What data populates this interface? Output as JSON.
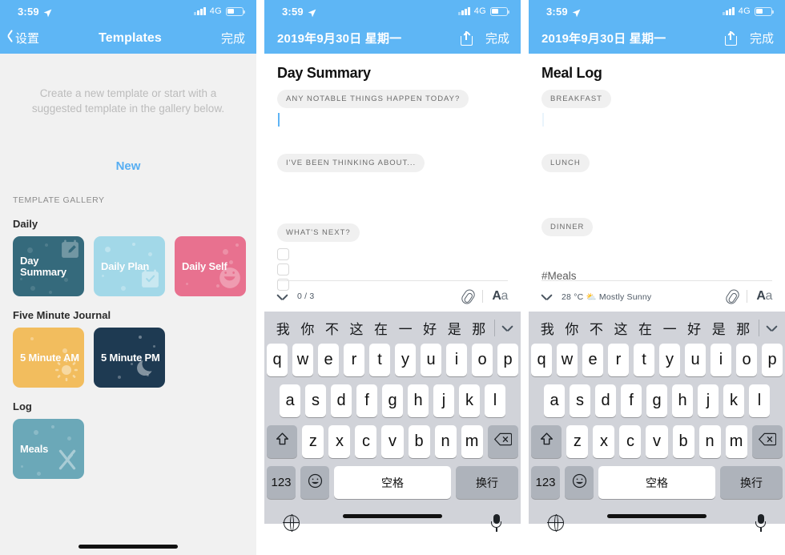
{
  "status_bar": {
    "time": "3:59",
    "network": "4G",
    "location_icon": "location-arrow-icon",
    "battery_icon": "battery-icon"
  },
  "panel1": {
    "nav": {
      "back_label": "设置",
      "title": "Templates",
      "done_label": "完成"
    },
    "empty_message": "Create a new template or start with a suggested template in the gallery below.",
    "new_label": "New",
    "gallery_header": "TEMPLATE GALLERY",
    "categories": [
      {
        "title": "Daily",
        "tiles": [
          {
            "label": "Day Summary",
            "color": "#356A7C",
            "art": "calendar-pencil-icon"
          },
          {
            "label": "Daily Plan",
            "color": "#A2D8E8",
            "art": "calendar-check-icon"
          },
          {
            "label": "Daily Self",
            "color": "#E8718F",
            "art": "smiley-icon"
          }
        ]
      },
      {
        "title": "Five Minute Journal",
        "tiles": [
          {
            "label": "5 Minute AM",
            "color": "#F2BD5E",
            "art": "sun-icon"
          },
          {
            "label": "5 Minute PM",
            "color": "#1E3A52",
            "art": "moon-icon"
          }
        ]
      },
      {
        "title": "Log",
        "tiles": [
          {
            "label": "Meals",
            "color": "#6BA8B8",
            "art": "fork-knife-icon"
          }
        ]
      }
    ]
  },
  "panel2": {
    "nav": {
      "date": "2019年9月30日 星期一",
      "share_icon": "share-icon",
      "done_label": "完成"
    },
    "note_title": "Day Summary",
    "prompts": [
      "ANY NOTABLE THINGS HAPPEN TODAY?",
      "I'VE BEEN THINKING ABOUT...",
      "WHAT'S NEXT?"
    ],
    "checkbox_count": 3,
    "toolbar": {
      "meta": "0 / 3",
      "chevron_icon": "chevron-down-icon",
      "attach_icon": "paperclip-icon",
      "format_label_bold": "A",
      "format_label_light": "a"
    }
  },
  "panel3": {
    "nav": {
      "date": "2019年9月30日 星期一",
      "share_icon": "share-icon",
      "done_label": "完成"
    },
    "note_title": "Meal Log",
    "prompts": [
      "BREAKFAST",
      "LUNCH",
      "DINNER"
    ],
    "hashtag": "#Meals",
    "toolbar": {
      "meta": "28 °C ⛅ Mostly Sunny",
      "chevron_icon": "chevron-down-icon",
      "attach_icon": "paperclip-icon",
      "format_label_bold": "A",
      "format_label_light": "a"
    }
  },
  "keyboard": {
    "candidates": [
      "我",
      "你",
      "不",
      "这",
      "在",
      "一",
      "好",
      "是",
      "那"
    ],
    "collapse_icon": "chevron-down-icon",
    "row1": [
      "q",
      "w",
      "e",
      "r",
      "t",
      "y",
      "u",
      "i",
      "o",
      "p"
    ],
    "row2": [
      "a",
      "s",
      "d",
      "f",
      "g",
      "h",
      "j",
      "k",
      "l"
    ],
    "row3": [
      "z",
      "x",
      "c",
      "v",
      "b",
      "n",
      "m"
    ],
    "shift_icon": "shift-icon",
    "backspace_icon": "backspace-icon",
    "num_label": "123",
    "emoji_icon": "emoji-icon",
    "space_label": "空格",
    "return_label": "换行",
    "globe_icon": "globe-icon",
    "mic_icon": "microphone-icon"
  },
  "colors": {
    "accent_blue": "#5EB6F5",
    "link_blue": "#57AEF2",
    "keyboard_bg": "#D1D3D9",
    "panel_bg": "#F1F1F1"
  }
}
